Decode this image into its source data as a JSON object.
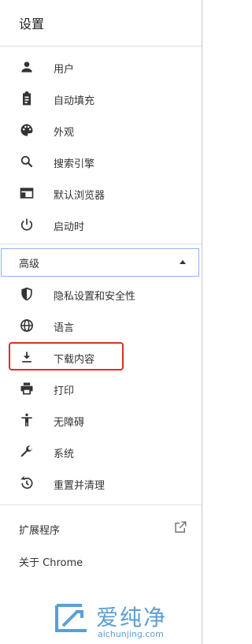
{
  "header": {
    "title": "设置"
  },
  "menu": [
    {
      "label": "用户",
      "icon": "person-icon"
    },
    {
      "label": "自动填充",
      "icon": "clipboard-icon"
    },
    {
      "label": "外观",
      "icon": "palette-icon"
    },
    {
      "label": "搜索引擎",
      "icon": "search-icon"
    },
    {
      "label": "默认浏览器",
      "icon": "browser-window-icon"
    },
    {
      "label": "启动时",
      "icon": "power-icon"
    }
  ],
  "advanced": {
    "label": "高级",
    "expanded": true
  },
  "advanced_menu": [
    {
      "label": "隐私设置和安全性",
      "icon": "shield-icon"
    },
    {
      "label": "语言",
      "icon": "globe-icon"
    },
    {
      "label": "下载内容",
      "icon": "download-icon"
    },
    {
      "label": "打印",
      "icon": "printer-icon"
    },
    {
      "label": "无障碍",
      "icon": "accessibility-icon"
    },
    {
      "label": "系统",
      "icon": "wrench-icon"
    },
    {
      "label": "重置并清理",
      "icon": "restore-icon"
    }
  ],
  "bottom": {
    "extensions_label": "扩展程序",
    "about_label": "关于 Chrome"
  },
  "watermark": {
    "big_text": "爱纯净",
    "small_text": "aichunjing.com"
  },
  "colors": {
    "icon": "#333333",
    "highlight": "#d93025",
    "focus_border": "#8ab4f8",
    "watermark": "#5a9fd4"
  }
}
